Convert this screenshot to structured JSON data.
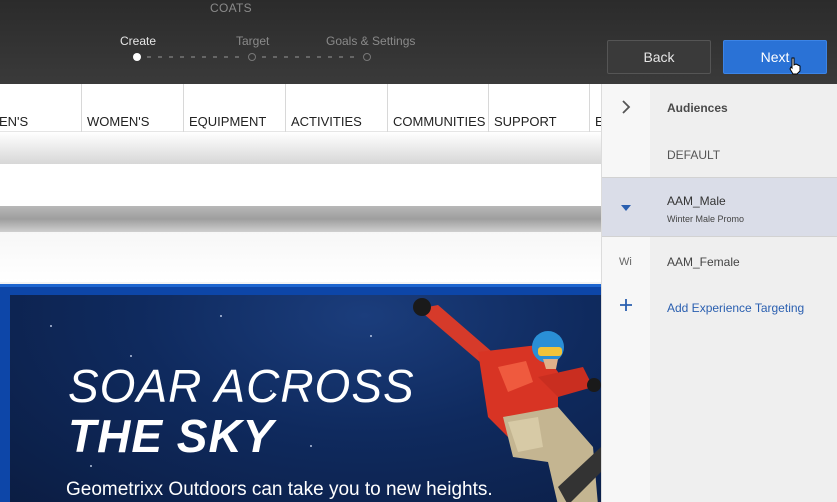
{
  "header": {
    "title": "COATS",
    "steps": [
      {
        "label": "Create",
        "active": true
      },
      {
        "label": "Target",
        "active": false
      },
      {
        "label": "Goals & Settings",
        "active": false
      }
    ],
    "back_label": "Back",
    "next_label": "Next",
    "accent_color": "#2a72d6"
  },
  "site": {
    "nav": [
      "EN'S",
      "WOMEN'S",
      "EQUIPMENT",
      "ACTIVITIES",
      "COMMUNITIES",
      "SUPPORT",
      "E"
    ],
    "hero": {
      "line1": "SOAR ACROSS",
      "line2": "THE SKY",
      "subtitle": "Geometrixx Outdoors can take you to new heights."
    }
  },
  "panel": {
    "audiences_label": "Audiences",
    "default_label": "DEFAULT",
    "male_label": "AAM_Male",
    "male_sub": "Winter Male Promo",
    "female_prefix": "Wi",
    "female_label": "AAM_Female",
    "add_label": "Add Experience Targeting",
    "link_color": "#2a5fb0"
  }
}
